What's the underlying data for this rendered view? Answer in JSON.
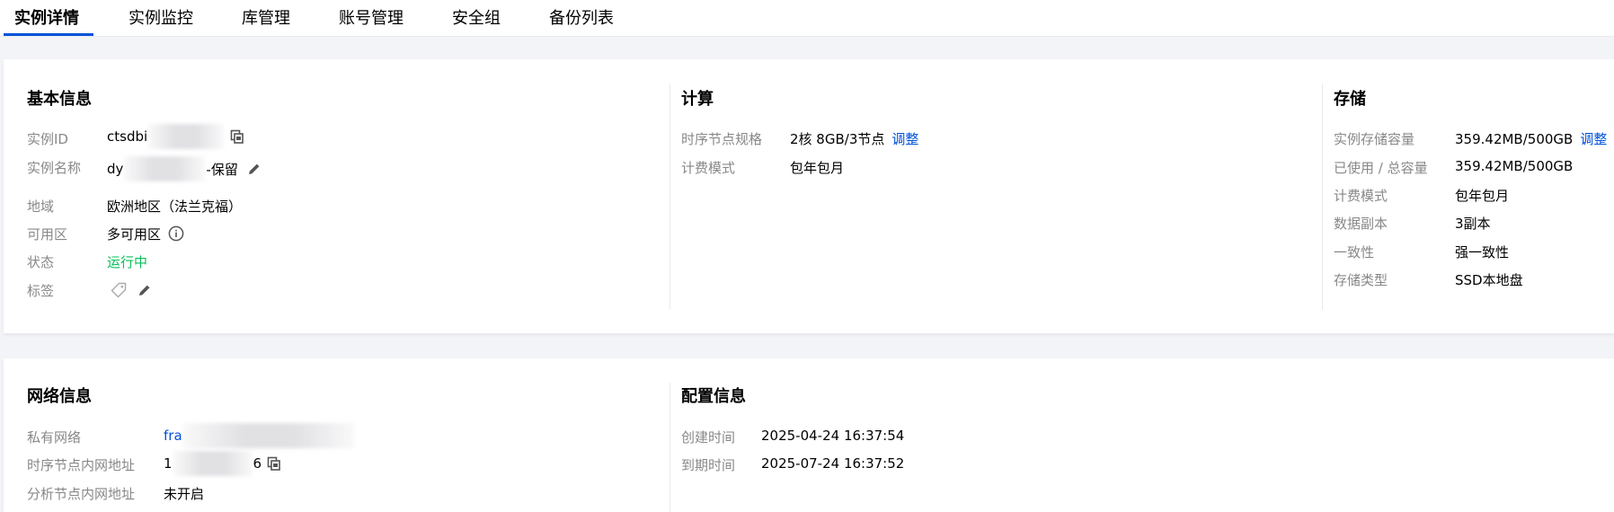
{
  "tabs": [
    {
      "label": "实例详情",
      "active": true
    },
    {
      "label": "实例监控"
    },
    {
      "label": "库管理"
    },
    {
      "label": "账号管理"
    },
    {
      "label": "安全组"
    },
    {
      "label": "备份列表"
    }
  ],
  "basic": {
    "title": "基本信息",
    "instance_id_label": "实例ID",
    "instance_id_prefix": "ctsdbi",
    "instance_name_label": "实例名称",
    "instance_name_prefix": "dy",
    "instance_name_suffix": "-保留",
    "region_label": "地域",
    "region_value": "欧洲地区（法兰克福）",
    "zone_label": "可用区",
    "zone_value": "多可用区",
    "status_label": "状态",
    "status_value": "运行中",
    "tag_label": "标签"
  },
  "compute": {
    "title": "计算",
    "spec_label": "时序节点规格",
    "spec_value": "2核 8GB/3节点",
    "adjust_link": "调整",
    "billing_label": "计费模式",
    "billing_value": "包年包月"
  },
  "storage": {
    "title": "存储",
    "capacity_label": "实例存储容量",
    "capacity_value": "359.42MB/500GB",
    "adjust_link": "调整",
    "used_label": "已使用 / 总容量",
    "used_value": "359.42MB/500GB",
    "billing_label": "计费模式",
    "billing_value": "包年包月",
    "replica_label": "数据副本",
    "replica_value": "3副本",
    "consistency_label": "一致性",
    "consistency_value": "强一致性",
    "type_label": "存储类型",
    "type_value": "SSD本地盘"
  },
  "network": {
    "title": "网络信息",
    "vpc_label": "私有网络",
    "vpc_prefix": "fra",
    "ts_addr_label": "时序节点内网地址",
    "ts_addr_prefix": "1",
    "ts_addr_suffix": "6",
    "analysis_addr_label": "分析节点内网地址",
    "analysis_addr_value": "未开启"
  },
  "config": {
    "title": "配置信息",
    "created_label": "创建时间",
    "created_value": "2025-04-24 16:37:54",
    "expire_label": "到期时间",
    "expire_value": "2025-07-24 16:37:52"
  },
  "colors": {
    "accent": "#0052d9",
    "success": "#0abf5b",
    "label": "#888888"
  }
}
